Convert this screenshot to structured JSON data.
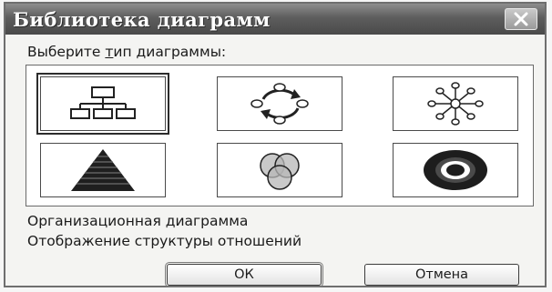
{
  "dialog": {
    "title": "Библиотека диаграмм",
    "close_icon": "close-x-icon"
  },
  "prompt": {
    "before": "Выберите ",
    "mnemonic": "т",
    "after": "ип диаграммы:"
  },
  "diagram_types": [
    {
      "icon": "org-chart-icon",
      "selected": true
    },
    {
      "icon": "cycle-diagram-icon",
      "selected": false
    },
    {
      "icon": "radial-diagram-icon",
      "selected": false
    },
    {
      "icon": "pyramid-diagram-icon",
      "selected": false
    },
    {
      "icon": "venn-diagram-icon",
      "selected": false
    },
    {
      "icon": "target-diagram-icon",
      "selected": false
    }
  ],
  "selection": {
    "name": "Организационная диаграмма",
    "description": "Отображение структуры отношений"
  },
  "buttons": {
    "ok_label": "ОК",
    "cancel_label": "Отмена"
  }
}
